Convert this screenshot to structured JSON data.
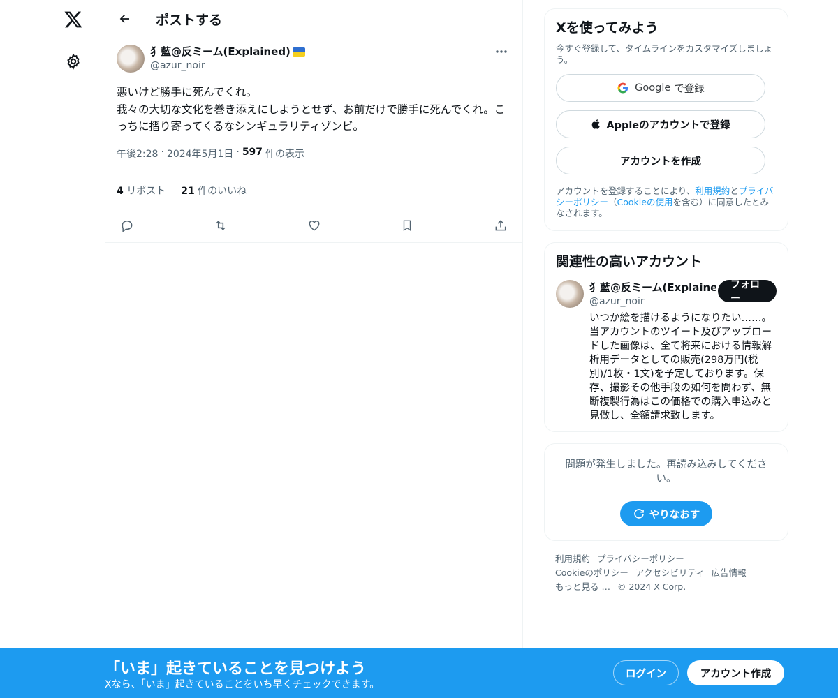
{
  "nav": {
    "logo_icon": "x-logo-icon",
    "settings_icon": "gear-icon"
  },
  "header": {
    "title": "ポストする"
  },
  "post": {
    "display_name": "犭藍@反ミーム(Explained)",
    "handle": "@azur_noir",
    "text": "悪いけど勝手に死んでくれ。\n我々の大切な文化を巻き添えにしようとせず、お前だけで勝手に死んでくれ。こっちに摺り寄ってくるなシンギュラリティゾンビ。",
    "time": "午後2:28",
    "date": "2024年5月1日",
    "views_count": "597",
    "views_label": "件の表示",
    "reposts_count": "4",
    "reposts_label": "リポスト",
    "likes_count": "21",
    "likes_label": "件のいいね"
  },
  "signup": {
    "title": "Xを使ってみよう",
    "subtitle": "今すぐ登録して、タイムラインをカスタマイズしましょう。",
    "google_label": "で登録",
    "google_brand": "Google",
    "apple_label": "Appleのアカウントで登録",
    "create_label": "アカウントを作成",
    "legal_pre": "アカウントを登録することにより、",
    "terms": "利用規約",
    "and": "と",
    "privacy": "プライバシーポリシー",
    "paren_open": "（",
    "cookie": "Cookieの使用",
    "legal_post": "を含む）に同意したとみなされます。"
  },
  "related": {
    "title": "関連性の高いアカウント",
    "name": "犭藍@反ミーム(Explained)",
    "handle": "@azur_noir",
    "follow_label": "フォロー",
    "bio": "いつか絵を描けるようになりたい……。当アカウントのツイート及びアップロードした画像は、全て将来における情報解析用データとしての販売(298万円(税別)/1枚・1文)を予定しております。保存、撮影その他手段の如何を問わず、無断複製行為はこの価格での購入申込みと見做し、全額請求致します。"
  },
  "error": {
    "message": "問題が発生しました。再読み込みしてください。",
    "retry_label": "やりなおす"
  },
  "footer": {
    "links": [
      "利用規約",
      "プライバシーポリシー",
      "Cookieのポリシー",
      "アクセシビリティ",
      "広告情報",
      "もっと見る …",
      "© 2024 X Corp."
    ]
  },
  "banner": {
    "title": "「いま」起きていることを見つけよう",
    "subtitle": "Xなら、「いま」起きていることをいち早くチェックできます。",
    "login_label": "ログイン",
    "signup_label": "アカウント作成"
  },
  "colors": {
    "accent": "#1d9bf0",
    "text": "#0f1419",
    "muted": "#536471"
  }
}
